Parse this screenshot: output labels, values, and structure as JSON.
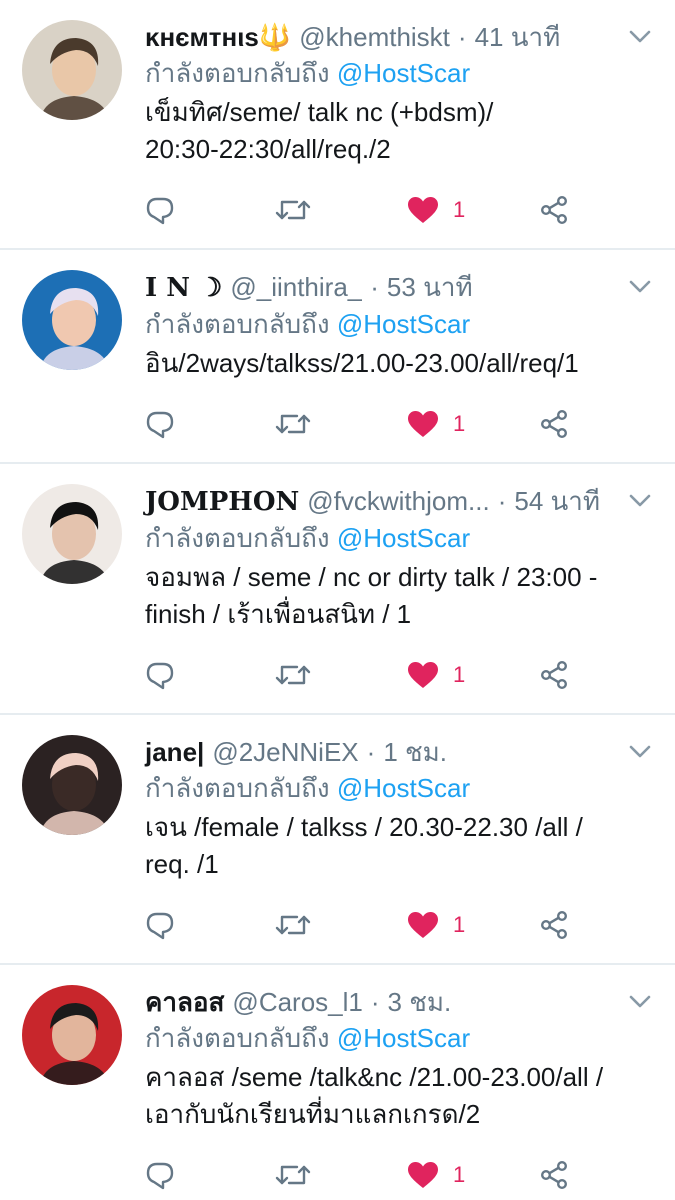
{
  "tweets": [
    {
      "display_name": "ĸнємтнιѕ🔱",
      "handle": "@khemthiskt",
      "sep": "·",
      "time": "41 นาที",
      "reply_prefix": "กำลังตอบกลับถึง",
      "reply_mention": "@HostScar",
      "text": "เข็มทิศ/seme/ talk nc (+bdsm)/\n20:30-22:30/all/req./2",
      "like_count": "1",
      "avatar_colors": [
        "#d9d2c6",
        "#4a3a2c",
        "#e9c7a8"
      ]
    },
    {
      "display_name": "I N ☽",
      "handle": "@_iinthira_",
      "sep": "·",
      "time": "53 นาที",
      "reply_prefix": "กำลังตอบกลับถึง",
      "reply_mention": "@HostScar",
      "text": "อิน/2ways/talkss/21.00-23.00/all/req/1",
      "like_count": "1",
      "avatar_colors": [
        "#1d6fb5",
        "#e7e0f0",
        "#f0c8b0"
      ]
    },
    {
      "display_name": "JOMPHON",
      "handle": "@fvckwithjom...",
      "sep": "·",
      "time": "54 นาที",
      "reply_prefix": "กำลังตอบกลับถึง",
      "reply_mention": "@HostScar",
      "text": "จอมพล / seme / nc or dirty talk / 23:00 -\nfinish / เร้าเพื่อนสนิท / 1",
      "like_count": "1",
      "avatar_colors": [
        "#efeae6",
        "#111111",
        "#e4c3ae"
      ]
    },
    {
      "display_name": "jane|",
      "handle": "@2JeNNiEX",
      "sep": "·",
      "time": "1 ชม.",
      "reply_prefix": "กำลังตอบกลับถึง",
      "reply_mention": "@HostScar",
      "text": "เจน /female / talkss / 20.30-22.30 /all /\nreq. /1",
      "like_count": "1",
      "avatar_colors": [
        "#2b2222",
        "#f0d0c4",
        "#3a2a26"
      ]
    },
    {
      "display_name": "คาลอส",
      "handle": "@Caros_l1",
      "sep": "·",
      "time": "3 ชม.",
      "reply_prefix": "กำลังตอบกลับถึง",
      "reply_mention": "@HostScar",
      "text": "คาลอส /seme /talk&nc /21.00-23.00/all /\nเอากับนักเรียนที่มาแลกเกรด/2",
      "like_count": "1",
      "avatar_colors": [
        "#c8262c",
        "#1b1b1b",
        "#e2b59c"
      ]
    }
  ],
  "colors": {
    "accent": "#1da1f2",
    "like": "#e0245e",
    "secondary_text": "#657786",
    "icon_gray": "#657786",
    "divider": "#e6ecf0"
  },
  "icons": [
    "reply-icon",
    "retweet-icon",
    "heart-icon",
    "share-icon",
    "chevron-down-icon"
  ]
}
